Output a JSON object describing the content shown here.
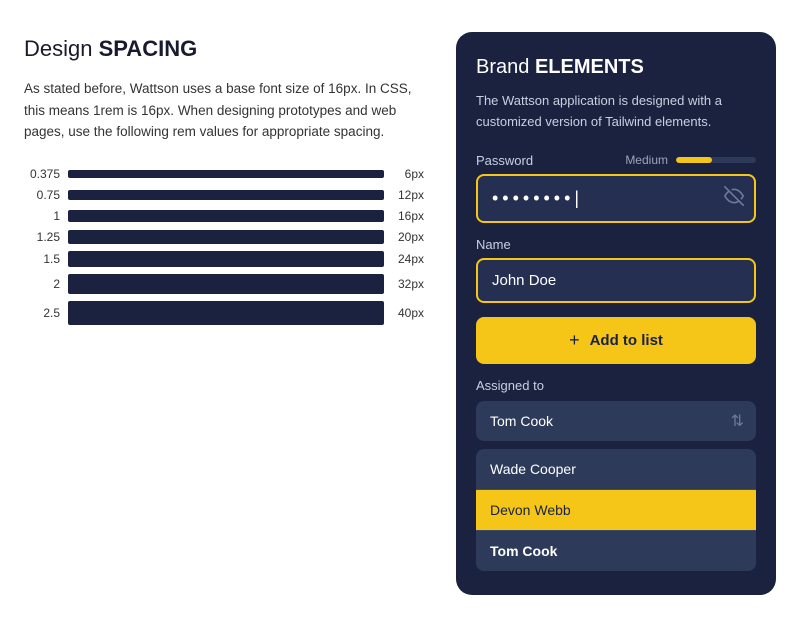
{
  "left": {
    "title_light": "Design ",
    "title_bold": "SPACING",
    "description": "As stated before, Wattson uses a base font size of 16px. In CSS, this means 1rem is 16px. When designing prototypes and web pages, use the following rem values for appropriate spacing.",
    "rows": [
      {
        "label": "0.375",
        "width_pct": 15,
        "height": 8,
        "px": "6px"
      },
      {
        "label": "0.75",
        "width_pct": 30,
        "height": 10,
        "px": "12px"
      },
      {
        "label": "1",
        "width_pct": 40,
        "height": 12,
        "px": "16px"
      },
      {
        "label": "1.25",
        "width_pct": 50,
        "height": 14,
        "px": "20px"
      },
      {
        "label": "1.5",
        "width_pct": 60,
        "height": 16,
        "px": "24px"
      },
      {
        "label": "2",
        "width_pct": 80,
        "height": 20,
        "px": "32px"
      },
      {
        "label": "2.5",
        "width_pct": 100,
        "height": 24,
        "px": "40px"
      }
    ]
  },
  "right": {
    "title_light": "Brand ",
    "title_bold": "ELEMENTS",
    "description": "The Wattson application is designed with a customized version of Tailwind elements.",
    "password_label": "Password",
    "strength_label": "Medium",
    "strength_pct": 45,
    "password_value": "••••••••|",
    "name_label": "Name",
    "name_placeholder": "John Doe",
    "add_btn_label": "Add to list",
    "assigned_label": "Assigned to",
    "select_value": "Tom Cook",
    "list_items": [
      {
        "text": "Wade Cooper",
        "active": false,
        "bold": false
      },
      {
        "text": "Devon Webb",
        "active": true,
        "bold": false
      },
      {
        "text": "Tom Cook",
        "active": false,
        "bold": true
      }
    ]
  }
}
